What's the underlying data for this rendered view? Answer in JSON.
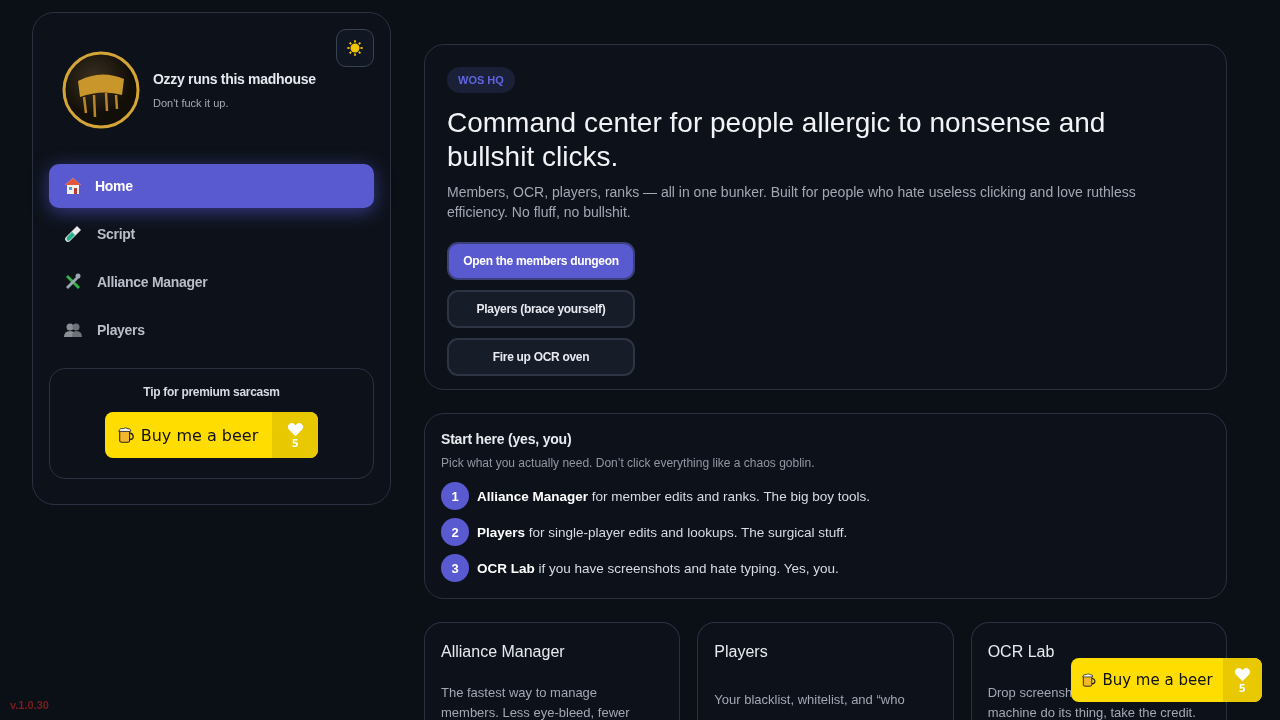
{
  "sidebar": {
    "title": "Ozzy runs this madhouse",
    "subtitle": "Don't fuck it up.",
    "nav": [
      {
        "label": "Home",
        "selected": true
      },
      {
        "label": "Script",
        "selected": false
      },
      {
        "label": "Alliance Manager",
        "selected": false
      },
      {
        "label": "Players",
        "selected": false
      }
    ],
    "tip": {
      "title": "Tip for premium sarcasm",
      "button": "Buy me a beer",
      "count": "5"
    }
  },
  "version": "v.1.0.30",
  "hero": {
    "badge": "WOS HQ",
    "title": "Command center for people allergic to nonsense and bullshit clicks.",
    "text": "Members, OCR, players, ranks — all in one bunker. Built for people who hate useless clicking and love ruthless efficiency. No fluff, no bullshit.",
    "buttons": [
      {
        "label": "Open the members dungeon",
        "kind": "primary"
      },
      {
        "label": "Players (brace yourself)",
        "kind": "secondary"
      },
      {
        "label": "Fire up OCR oven",
        "kind": "secondary"
      }
    ]
  },
  "start": {
    "title": "Start here (yes, you)",
    "subtitle": "Pick what you actually need. Don’t click everything like a chaos goblin.",
    "steps": [
      {
        "number": "1",
        "text": "**Alliance Manager** for member edits and ranks. The big boy tools."
      },
      {
        "number": "2",
        "text": "**Players** for single-player edits and lookups. The surgical stuff."
      },
      {
        "number": "3",
        "text": "**OCR Lab** if you have screenshots and hate typing. Yes, you."
      }
    ]
  },
  "cards": [
    {
      "title": "Alliance Manager",
      "lines": [
        "The fastest way to manage",
        "members. Less eye-bleed, fewer"
      ]
    },
    {
      "title": "Players",
      "lines": [
        "Your blacklist, whitelist, and “who"
      ]
    },
    {
      "title": "OCR Lab",
      "lines": [
        "Drop screensh",
        "machine do its thing, take the credit."
      ]
    }
  ],
  "floating_tip": {
    "button": "Buy me a beer",
    "count": "5"
  }
}
